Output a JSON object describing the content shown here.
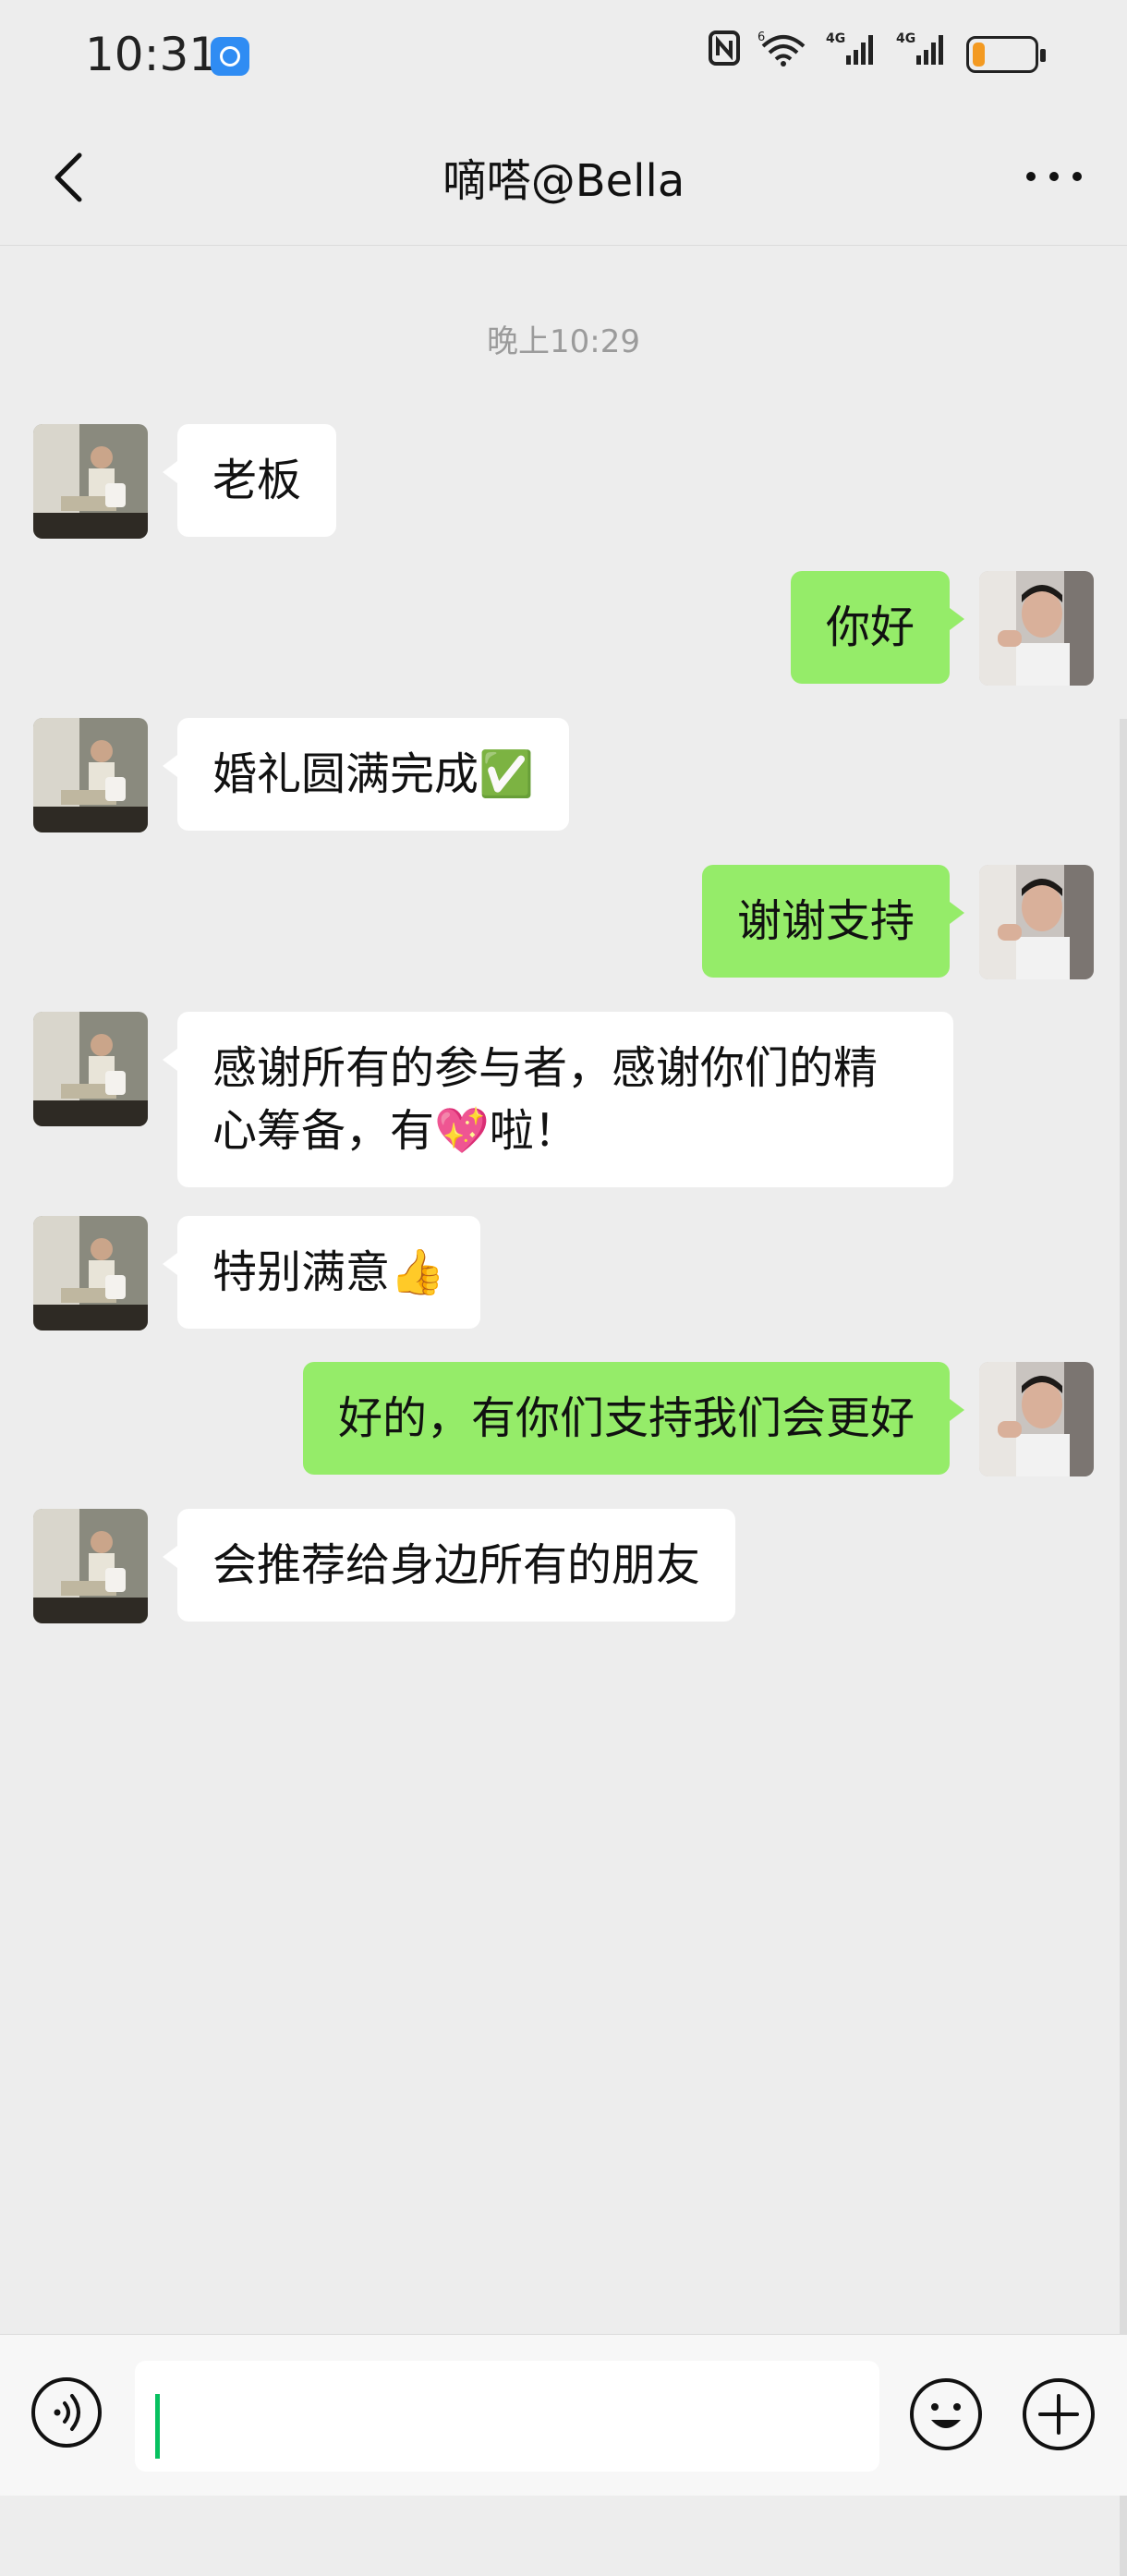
{
  "status_bar": {
    "time": "10:31",
    "icons": [
      "nfc-icon",
      "wifi-6-icon",
      "signal-4g-icon",
      "signal-4g-icon",
      "battery-low-icon"
    ],
    "signal_label_1": "4G",
    "signal_label_2": "4G",
    "wifi_label": "6",
    "battery_level": 0.2,
    "battery_color": "#f39a22"
  },
  "nav": {
    "title": "嘀嗒@Bella",
    "back_icon": "chevron-left-icon",
    "more_icon": "ellipsis-icon"
  },
  "chat": {
    "timestamp": "晚上10:29",
    "messages": [
      {
        "side": "left",
        "text": "老板"
      },
      {
        "side": "right",
        "text": "你好"
      },
      {
        "side": "left",
        "text": "婚礼圆满完成✅"
      },
      {
        "side": "right",
        "text": "谢谢支持"
      },
      {
        "side": "left",
        "text": "感谢所有的参与者，感谢你们的精心筹备，有💖啦！"
      },
      {
        "side": "left",
        "text": "特别满意👍"
      },
      {
        "side": "right",
        "text": "好的，有你们支持我们会更好"
      },
      {
        "side": "left",
        "text": "会推荐给身边所有的朋友"
      }
    ]
  },
  "input_bar": {
    "voice_icon": "voice-icon",
    "input_value": "",
    "emoji_icon": "emoji-icon",
    "plus_icon": "plus-circle-icon"
  },
  "colors": {
    "background": "#ededed",
    "self_bubble": "#95ec69",
    "other_bubble": "#ffffff",
    "cursor": "#07c160"
  }
}
